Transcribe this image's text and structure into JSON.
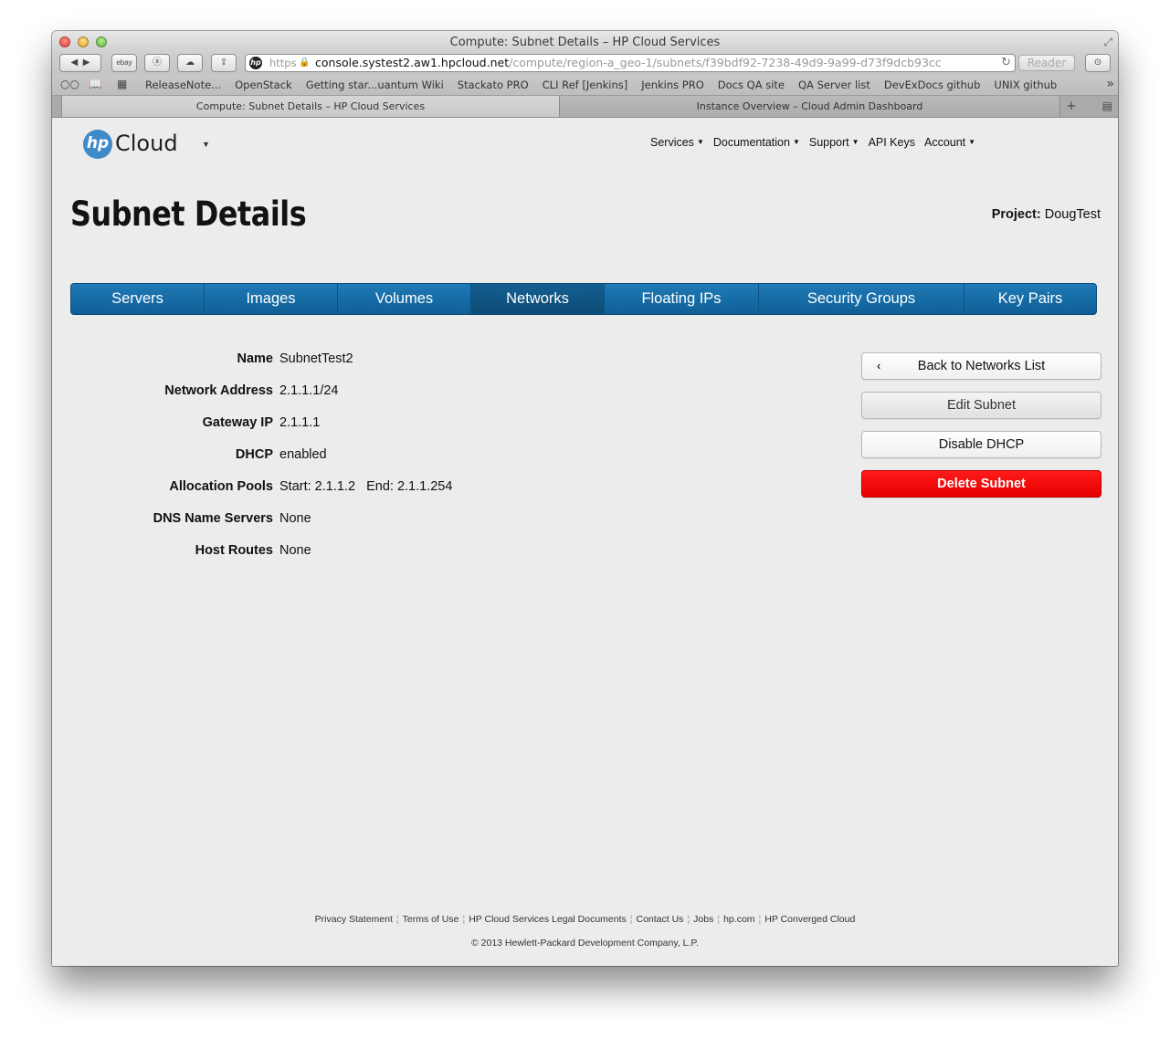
{
  "browser": {
    "window_title": "Compute: Subnet Details – HP Cloud Services",
    "toolbar": {
      "ebay_label": "ebay"
    },
    "address": {
      "scheme": "https",
      "host": "console.systest2.aw1.hpcloud.net",
      "path": "/compute/region-a_geo-1/subnets/f39bdf92-7238-49d9-9a99-d73f9dcb93cc"
    },
    "reader_label": "Reader",
    "bookmarks": [
      "ReleaseNote...",
      "OpenStack",
      "Getting star...uantum Wiki",
      "Stackato PRO",
      "CLI Ref [Jenkins]",
      "Jenkins PRO",
      "Docs QA site",
      "QA Server list",
      "DevExDocs github",
      "UNIX github"
    ],
    "tabs": [
      {
        "label": "Compute: Subnet Details – HP Cloud Services",
        "active": true
      },
      {
        "label": "Instance Overview – Cloud Admin Dashboard",
        "active": false
      }
    ]
  },
  "header": {
    "logo_badge": "hp",
    "logo_text": "Cloud",
    "nav": [
      {
        "label": "Services",
        "dropdown": true
      },
      {
        "label": "Documentation",
        "dropdown": true
      },
      {
        "label": "Support",
        "dropdown": true
      },
      {
        "label": "API Keys",
        "dropdown": false
      },
      {
        "label": "Account",
        "dropdown": true
      }
    ]
  },
  "page": {
    "title": "Subnet Details",
    "project_label": "Project:",
    "project_value": "DougTest"
  },
  "main_nav": [
    {
      "label": "Servers",
      "active": false
    },
    {
      "label": "Images",
      "active": false
    },
    {
      "label": "Volumes",
      "active": false
    },
    {
      "label": "Networks",
      "active": true
    },
    {
      "label": "Floating IPs",
      "active": false
    },
    {
      "label": "Security Groups",
      "active": false
    },
    {
      "label": "Key Pairs",
      "active": false
    }
  ],
  "details": [
    {
      "label": "Name",
      "value": "SubnetTest2"
    },
    {
      "label": "Network Address",
      "value": "2.1.1.1/24"
    },
    {
      "label": "Gateway IP",
      "value": "2.1.1.1"
    },
    {
      "label": "DHCP",
      "value": "enabled"
    },
    {
      "label": "Allocation Pools",
      "value": "Start: 2.1.1.2   End: 2.1.1.254"
    },
    {
      "label": "DNS Name Servers",
      "value": "None"
    },
    {
      "label": "Host Routes",
      "value": "None"
    }
  ],
  "actions": {
    "back": "Back to Networks List",
    "edit": "Edit Subnet",
    "disable_dhcp": "Disable DHCP",
    "delete": "Delete Subnet"
  },
  "footer": {
    "links": [
      "Privacy Statement",
      "Terms of Use",
      "HP Cloud Services Legal Documents",
      "Contact Us",
      "Jobs",
      "hp.com",
      "HP Converged Cloud"
    ],
    "copyright": "© 2013 Hewlett-Packard Development Company, L.P."
  },
  "colors": {
    "nav_blue": "#1a72ad",
    "danger_red": "#ff0000",
    "logo_blue": "#3f8ac9"
  }
}
